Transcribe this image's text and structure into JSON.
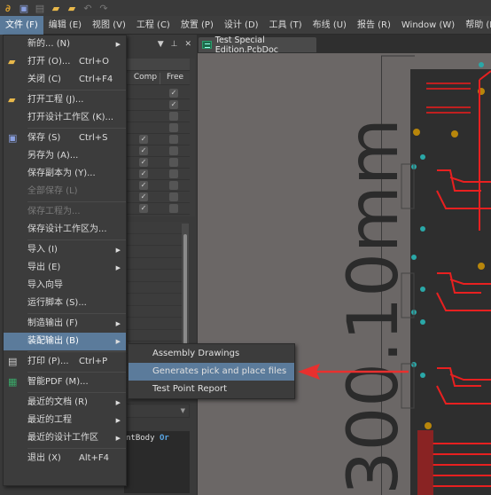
{
  "toolbar": {
    "icons": [
      "app-logo-icon",
      "save-icon",
      "save-all-icon",
      "open-icon",
      "open-project-icon",
      "undo-icon",
      "redo-icon"
    ]
  },
  "menubar": {
    "items": [
      {
        "label": "文件 (F)",
        "active": true
      },
      {
        "label": "编辑 (E)"
      },
      {
        "label": "视图 (V)"
      },
      {
        "label": "工程 (C)"
      },
      {
        "label": "放置 (P)"
      },
      {
        "label": "设计 (D)"
      },
      {
        "label": "工具 (T)"
      },
      {
        "label": "布线 (U)"
      },
      {
        "label": "报告 (R)"
      },
      {
        "label": "Window (W)"
      },
      {
        "label": "帮助 (H)"
      }
    ]
  },
  "panel": {
    "header_icons": [
      "dropdown-icon",
      "pin-icon",
      "close-icon"
    ],
    "columns": [
      "Comp",
      "Free"
    ],
    "rows": [
      {
        "comp": null,
        "free": true
      },
      {
        "comp": null,
        "free": true
      },
      {
        "comp": null,
        "free": false
      },
      {
        "comp": null,
        "free": false
      },
      {
        "comp": true,
        "free": false
      },
      {
        "comp": true,
        "free": false
      },
      {
        "comp": true,
        "free": false
      },
      {
        "comp": true,
        "free": false
      },
      {
        "comp": true,
        "free": false
      },
      {
        "comp": true,
        "free": false
      },
      {
        "comp": true,
        "free": false
      }
    ],
    "query_text": "ntBody",
    "query_keyword": "Or"
  },
  "document": {
    "tab_label": "Test Special Edition.PcbDoc",
    "dimension_text": "300.10mm"
  },
  "file_menu": {
    "items": [
      {
        "label": "新的... (N)",
        "submenu": true
      },
      {
        "label": "打开 (O)...",
        "shortcut": "Ctrl+O",
        "icon": "open-folder-icon"
      },
      {
        "label": "关闭 (C)",
        "shortcut": "Ctrl+F4"
      },
      {
        "sep": true
      },
      {
        "label": "打开工程 (J)...",
        "icon": "open-project-icon"
      },
      {
        "label": "打开设计工作区 (K)..."
      },
      {
        "sep": true
      },
      {
        "label": "保存 (S)",
        "shortcut": "Ctrl+S",
        "icon": "save-icon"
      },
      {
        "label": "另存为 (A)..."
      },
      {
        "label": "保存副本为 (Y)..."
      },
      {
        "label": "全部保存 (L)",
        "disabled": true
      },
      {
        "sep": true
      },
      {
        "label": "保存工程为...",
        "disabled": true
      },
      {
        "label": "保存设计工作区为..."
      },
      {
        "sep": true
      },
      {
        "label": "导入 (I)",
        "submenu": true
      },
      {
        "label": "导出 (E)",
        "submenu": true
      },
      {
        "label": "导入向导"
      },
      {
        "label": "运行脚本 (S)..."
      },
      {
        "sep": true
      },
      {
        "label": "制造输出 (F)",
        "submenu": true
      },
      {
        "label": "装配输出 (B)",
        "submenu": true,
        "highlighted": true
      },
      {
        "sep": true
      },
      {
        "label": "打印 (P)...",
        "shortcut": "Ctrl+P",
        "icon": "print-icon"
      },
      {
        "sep": true
      },
      {
        "label": "智能PDF (M)...",
        "icon": "smart-pdf-icon"
      },
      {
        "sep": true
      },
      {
        "label": "最近的文档 (R)",
        "submenu": true
      },
      {
        "label": "最近的工程",
        "submenu": true
      },
      {
        "label": "最近的设计工作区",
        "submenu": true
      },
      {
        "sep": true
      },
      {
        "label": "退出 (X)",
        "shortcut": "Alt+F4"
      }
    ]
  },
  "assembly_submenu": {
    "items": [
      {
        "label": "Assembly Drawings"
      },
      {
        "label": "Generates pick and place files",
        "highlighted": true
      },
      {
        "label": "Test Point Report"
      }
    ]
  },
  "annotation": {
    "arrow_color": "#e8302e"
  }
}
